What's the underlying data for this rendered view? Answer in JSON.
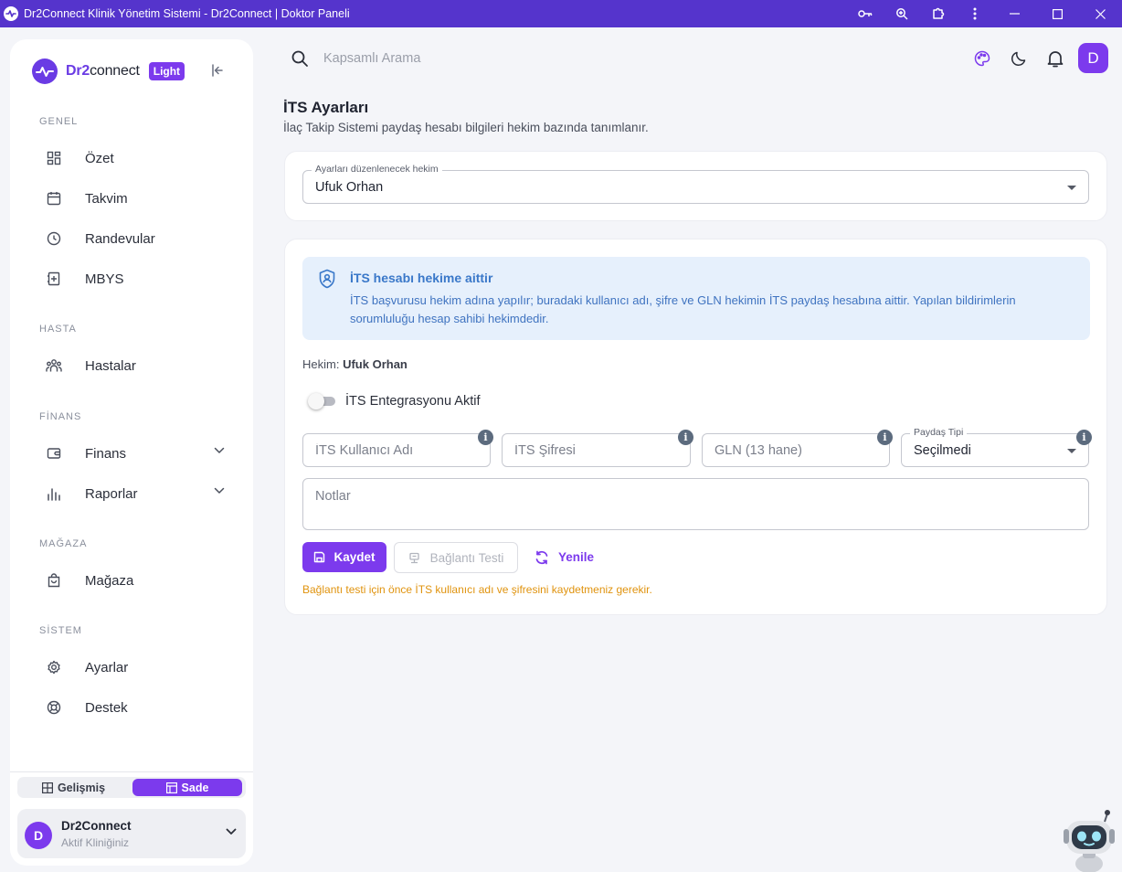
{
  "window": {
    "title": "Dr2Connect Klinik Yönetim Sistemi - Dr2Connect | Doktor Paneli"
  },
  "brand": {
    "name_part1": "Dr2",
    "name_part2": "connect",
    "theme_badge": "Light"
  },
  "sidebar": {
    "sections": {
      "genel": "GENEL",
      "hasta": "HASTA",
      "finans": "FİNANS",
      "magaza": "MAĞAZA",
      "sistem": "SİSTEM"
    },
    "items": {
      "ozet": "Özet",
      "takvim": "Takvim",
      "randevular": "Randevular",
      "mbys": "MBYS",
      "hastalar": "Hastalar",
      "finans": "Finans",
      "raporlar": "Raporlar",
      "magaza": "Mağaza",
      "ayarlar": "Ayarlar",
      "destek": "Destek"
    },
    "mode": {
      "advanced": "Gelişmiş",
      "simple": "Sade",
      "active": "Sade"
    },
    "clinic": {
      "avatar_letter": "D",
      "name": "Dr2Connect",
      "subtitle": "Aktif Kliniğiniz"
    }
  },
  "topbar": {
    "search_placeholder": "Kapsamlı Arama",
    "avatar_letter": "D"
  },
  "page": {
    "title": "İTS Ayarları",
    "subtitle": "İlaç Takip Sistemi paydaş hesabı bilgileri hekim bazında tanımlanır.",
    "doctor_select": {
      "label": "Ayarları düzenlenecek hekim",
      "value": "Ufuk Orhan"
    },
    "alert": {
      "title": "İTS hesabı hekime aittir",
      "text": "İTS başvurusu hekim adına yapılır; buradaki kullanıcı adı, şifre ve GLN hekimin İTS paydaş hesabına aittir. Yapılan bildirimlerin sorumluluğu hesap sahibi hekimdedir."
    },
    "doctor_line": {
      "label": "Hekim:",
      "name": "Ufuk Orhan"
    },
    "integration_toggle": {
      "label": "İTS Entegrasyonu Aktif",
      "enabled": false
    },
    "fields": {
      "username_placeholder": "İTS Kullanıcı Adı",
      "password_placeholder": "İTS Şifresi",
      "gln_placeholder": "GLN (13 hane)",
      "stakeholder_label": "Paydaş Tipi",
      "stakeholder_value": "Seçilmedi",
      "notes_placeholder": "Notlar"
    },
    "buttons": {
      "save": "Kaydet",
      "test": "Bağlantı Testi",
      "refresh": "Yenile"
    },
    "warning": "Bağlantı testi için önce İTS kullanıcı adı ve şifresini kaydetmeniz gerekir."
  },
  "colors": {
    "titlebar": "#5534cc",
    "accent": "#7c3aed",
    "alert_bg": "#e6f0fc",
    "alert_text": "#3f73c0",
    "warning": "#e0930e"
  }
}
